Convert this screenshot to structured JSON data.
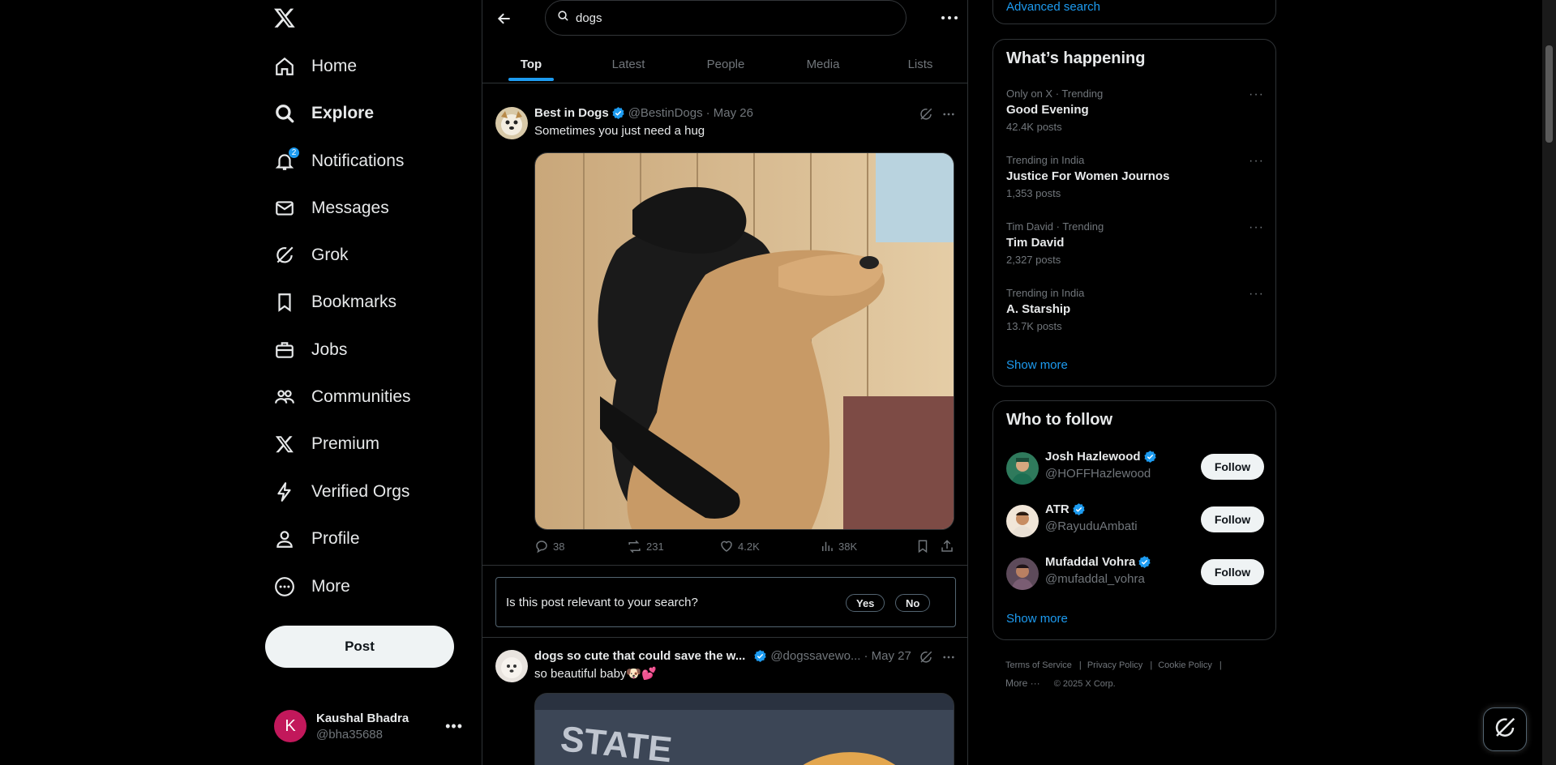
{
  "nav": {
    "items": [
      {
        "label": "Home",
        "icon": "home-icon"
      },
      {
        "label": "Explore",
        "icon": "search-icon"
      },
      {
        "label": "Notifications",
        "icon": "bell-icon",
        "badge": "2"
      },
      {
        "label": "Messages",
        "icon": "envelope-icon"
      },
      {
        "label": "Grok",
        "icon": "grok-icon"
      },
      {
        "label": "Bookmarks",
        "icon": "bookmark-icon"
      },
      {
        "label": "Jobs",
        "icon": "briefcase-icon"
      },
      {
        "label": "Communities",
        "icon": "people-icon"
      },
      {
        "label": "Premium",
        "icon": "x-logo-icon"
      },
      {
        "label": "Verified Orgs",
        "icon": "lightning-icon"
      },
      {
        "label": "Profile",
        "icon": "person-icon"
      },
      {
        "label": "More",
        "icon": "more-circle-icon"
      }
    ],
    "post_label": "Post"
  },
  "account": {
    "initial": "K",
    "name": "Kaushal Bhadra",
    "handle": "@bha35688"
  },
  "search": {
    "query": "dogs",
    "tabs": [
      "Top",
      "Latest",
      "People",
      "Media",
      "Lists"
    ],
    "active_tab": "Top"
  },
  "tweets": [
    {
      "name": "Best in Dogs",
      "handle": "@BestinDogs",
      "date": "· May 26",
      "text": "Sometimes you just need a hug",
      "replies": "38",
      "reposts": "231",
      "likes": "4.2K",
      "views": "38K"
    },
    {
      "name": "dogs so cute that could save the w...",
      "handle": "@dogssavewo...",
      "date": "· May 27",
      "text": "so beautiful baby🐶💕"
    }
  ],
  "relevance": {
    "question": "Is this post relevant to your search?",
    "yes": "Yes",
    "no": "No"
  },
  "right": {
    "advanced_search": "Advanced search",
    "happening_title": "What’s happening",
    "trends": [
      {
        "meta": "Only on X · Trending",
        "name": "Good Evening",
        "count": "42.4K posts"
      },
      {
        "meta": "Trending in India",
        "name": "Justice For Women Journos",
        "count": "1,353 posts"
      },
      {
        "meta": "Tim David · Trending",
        "name": "Tim David",
        "count": "2,327 posts"
      },
      {
        "meta": "Trending in India",
        "name": "A. Starship",
        "count": "13.7K posts"
      }
    ],
    "show_more": "Show more",
    "follow_title": "Who to follow",
    "follows": [
      {
        "name": "Josh Hazlewood",
        "handle": "@HOFFHazlewood",
        "button": "Follow"
      },
      {
        "name": "ATR",
        "handle": "@RayuduAmbati",
        "button": "Follow"
      },
      {
        "name": "Mufaddal Vohra",
        "handle": "@mufaddal_vohra",
        "button": "Follow"
      }
    ],
    "footer": {
      "terms": "Terms of Service",
      "privacy": "Privacy Policy",
      "cookie": "Cookie Policy",
      "more": "More ···",
      "copyright": "© 2025 X Corp."
    }
  },
  "colors": {
    "accent": "#1d9bf0",
    "background": "#000000",
    "text": "#e7e9ea",
    "muted": "#71767b"
  }
}
